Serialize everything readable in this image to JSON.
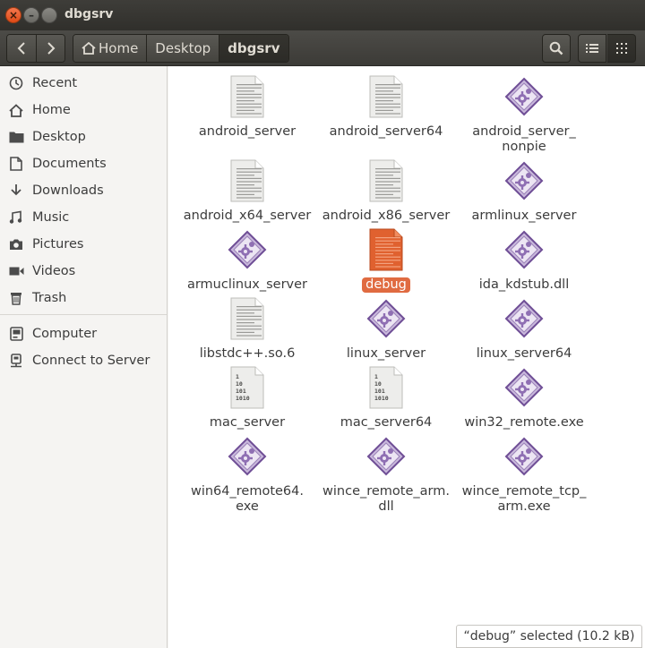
{
  "window": {
    "title": "dbgsrv"
  },
  "toolbar": {
    "back_icon": "chevron-left-icon",
    "forward_icon": "chevron-right-icon",
    "breadcrumbs": [
      "Home",
      "Desktop",
      "dbgsrv"
    ],
    "search_icon": "search-icon",
    "list_view_icon": "list-view-icon",
    "grid_view_icon": "grid-view-icon"
  },
  "sidebar": {
    "items": [
      {
        "label": "Recent",
        "icon": "clock-icon"
      },
      {
        "label": "Home",
        "icon": "home-icon"
      },
      {
        "label": "Desktop",
        "icon": "folder-icon"
      },
      {
        "label": "Documents",
        "icon": "document-icon"
      },
      {
        "label": "Downloads",
        "icon": "download-icon"
      },
      {
        "label": "Music",
        "icon": "music-icon"
      },
      {
        "label": "Pictures",
        "icon": "camera-icon"
      },
      {
        "label": "Videos",
        "icon": "video-icon"
      },
      {
        "label": "Trash",
        "icon": "trash-icon"
      },
      {
        "label": "Computer",
        "icon": "computer-icon"
      },
      {
        "label": "Connect to Server",
        "icon": "server-icon"
      }
    ]
  },
  "files": [
    {
      "name": "android_server",
      "type": "text"
    },
    {
      "name": "android_server64",
      "type": "text"
    },
    {
      "name": "android_server_\nnonpie",
      "type": "executable"
    },
    {
      "name": "android_x64_server",
      "type": "text"
    },
    {
      "name": "android_x86_server",
      "type": "text"
    },
    {
      "name": "armlinux_server",
      "type": "executable"
    },
    {
      "name": "armuclinux_server",
      "type": "executable"
    },
    {
      "name": "debug",
      "type": "text-selected",
      "selected": true
    },
    {
      "name": "ida_kdstub.dll",
      "type": "executable"
    },
    {
      "name": "libstdc++.so.6",
      "type": "text"
    },
    {
      "name": "linux_server",
      "type": "executable"
    },
    {
      "name": "linux_server64",
      "type": "executable"
    },
    {
      "name": "mac_server",
      "type": "binary"
    },
    {
      "name": "mac_server64",
      "type": "binary"
    },
    {
      "name": "win32_remote.exe",
      "type": "executable"
    },
    {
      "name": "win64_remote64.\nexe",
      "type": "executable"
    },
    {
      "name": "wince_remote_arm.\ndll",
      "type": "executable"
    },
    {
      "name": "wince_remote_tcp_\narm.exe",
      "type": "executable"
    }
  ],
  "binary_icon_text": [
    "1",
    "10",
    "101",
    "1010"
  ],
  "status": {
    "text": "“debug” selected  (10.2 kB)"
  },
  "colors": {
    "selection": "#e06b41",
    "titlebar": "#3c3b37",
    "executable_icon": "#8f6fb3"
  }
}
